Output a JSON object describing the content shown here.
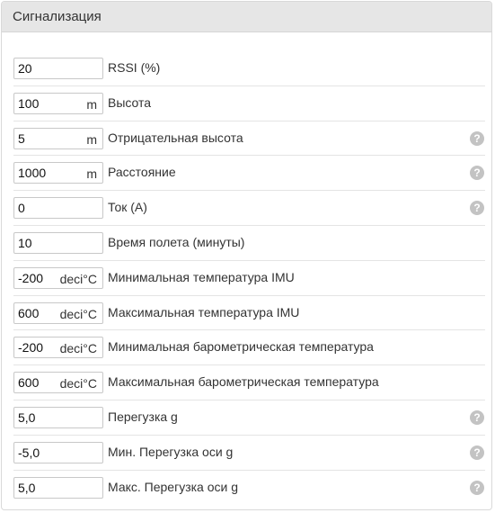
{
  "panel": {
    "title": "Сигнализация"
  },
  "rows": [
    {
      "value": "20",
      "unit": "",
      "label": "RSSI (%)",
      "help": false
    },
    {
      "value": "100",
      "unit": "m",
      "label": "Высота",
      "help": false
    },
    {
      "value": "5",
      "unit": "m",
      "label": "Отрицательная высота",
      "help": true
    },
    {
      "value": "1000",
      "unit": "m",
      "label": "Расстояние",
      "help": true
    },
    {
      "value": "0",
      "unit": "",
      "label": "Ток (A)",
      "help": true
    },
    {
      "value": "10",
      "unit": "",
      "label": "Время полета (минуты)",
      "help": false
    },
    {
      "value": "-200",
      "unit": "deci°C",
      "label": "Минимальная температура IMU",
      "help": false
    },
    {
      "value": "600",
      "unit": "deci°C",
      "label": "Максимальная температура IMU",
      "help": false
    },
    {
      "value": "-200",
      "unit": "deci°C",
      "label": "Минимальная барометрическая температура",
      "help": false
    },
    {
      "value": "600",
      "unit": "deci°C",
      "label": "Максимальная барометрическая температура",
      "help": false
    },
    {
      "value": "5,0",
      "unit": "",
      "label": "Перегузка g",
      "help": true
    },
    {
      "value": "-5,0",
      "unit": "",
      "label": "Мин. Перегузка оси g",
      "help": true
    },
    {
      "value": "5,0",
      "unit": "",
      "label": "Макс. Перегузка оси g",
      "help": true
    }
  ],
  "help_glyph": "?",
  "icons": {
    "help": "question-circle-icon"
  },
  "colors": {
    "header_bg": "#e6e6e6",
    "help_icon": "#c3c3c3",
    "row_divider": "#e4e4e4"
  }
}
